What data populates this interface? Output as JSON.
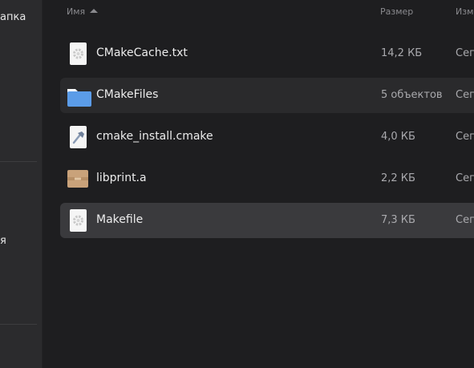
{
  "sidebar": {
    "item_top": "апка",
    "item_mid": "я"
  },
  "columns": {
    "name": "Имя",
    "size": "Размер",
    "modified": "Измо"
  },
  "files": [
    {
      "name": "CMakeCache.txt",
      "size": "14,2 КБ",
      "modified": "Сего",
      "icon": "text-file-gear-icon"
    },
    {
      "name": "CMakeFiles",
      "size": "5 объектов",
      "modified": "Сего",
      "icon": "folder-icon"
    },
    {
      "name": "cmake_install.cmake",
      "size": "4,0 КБ",
      "modified": "Сего",
      "icon": "hammer-file-icon"
    },
    {
      "name": "libprint.a",
      "size": "2,2 КБ",
      "modified": "Сего",
      "icon": "archive-box-icon"
    },
    {
      "name": "Makefile",
      "size": "7,3 КБ",
      "modified": "Сего",
      "icon": "text-file-gear-icon"
    }
  ],
  "colors": {
    "background": "#1e1e20",
    "sidebar": "#2b2b2d",
    "selected_row": "#3a3a3d",
    "folder": "#5b9ce8",
    "archive": "#c9a27a"
  }
}
